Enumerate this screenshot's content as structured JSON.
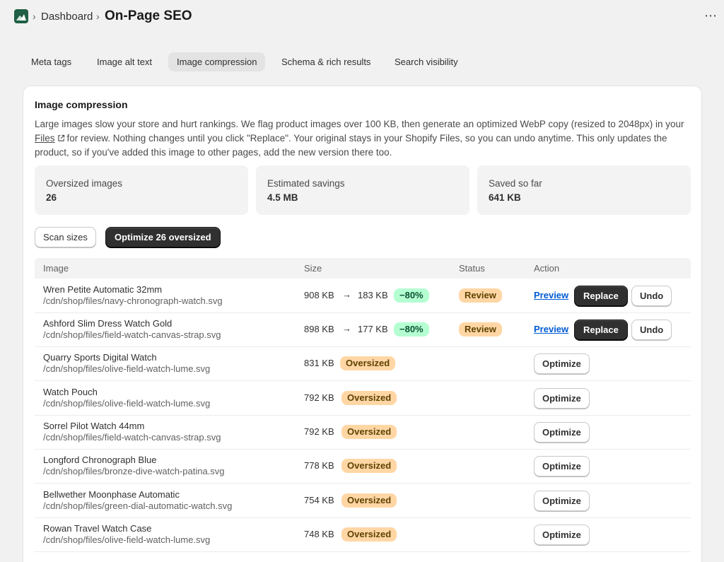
{
  "header": {
    "breadcrumb_sep": "›",
    "breadcrumb_parent": "Dashboard",
    "page_title": "On-Page SEO",
    "more_icon": "⋯"
  },
  "tabs": [
    {
      "label": "Meta tags",
      "active": false
    },
    {
      "label": "Image alt text",
      "active": false
    },
    {
      "label": "Image compression",
      "active": true
    },
    {
      "label": "Schema & rich results",
      "active": false
    },
    {
      "label": "Search visibility",
      "active": false
    }
  ],
  "card": {
    "title": "Image compression",
    "desc_part1": "Large images slow your store and hurt rankings. We flag product images over 100 KB, then generate an optimized WebP copy (resized to 2048px) in your ",
    "desc_link": "Files",
    "desc_part2": "for review. Nothing changes until you click \"Replace\". Your original stays in your Shopify Files, so you can undo anytime. This only updates the product, so if you've added this image to other pages, add the new version there too."
  },
  "stats": [
    {
      "label": "Oversized images",
      "value": "26"
    },
    {
      "label": "Estimated savings",
      "value": "4.5 MB"
    },
    {
      "label": "Saved so far",
      "value": "641 KB"
    }
  ],
  "buttons": {
    "scan": "Scan sizes",
    "optimize_all": "Optimize 26 oversized"
  },
  "table": {
    "headers": {
      "image": "Image",
      "size": "Size",
      "status": "Status",
      "action": "Action"
    },
    "arrow": "→",
    "rows": [
      {
        "name": "Wren Petite Automatic 32mm",
        "path": "/cdn/shop/files/navy-chronograph-watch.svg",
        "size": "908 KB",
        "new_size": "183 KB",
        "savings": "−80%",
        "status": "Review",
        "preview": "Preview",
        "replace": "Replace",
        "undo": "Undo"
      },
      {
        "name": "Ashford Slim Dress Watch Gold",
        "path": "/cdn/shop/files/field-watch-canvas-strap.svg",
        "size": "898 KB",
        "new_size": "177 KB",
        "savings": "−80%",
        "status": "Review",
        "preview": "Preview",
        "replace": "Replace",
        "undo": "Undo"
      },
      {
        "name": "Quarry Sports Digital Watch",
        "path": "/cdn/shop/files/olive-field-watch-lume.svg",
        "size": "831 KB",
        "badge": "Oversized",
        "action": "Optimize"
      },
      {
        "name": "Watch Pouch",
        "path": "/cdn/shop/files/olive-field-watch-lume.svg",
        "size": "792 KB",
        "badge": "Oversized",
        "action": "Optimize"
      },
      {
        "name": "Sorrel Pilot Watch 44mm",
        "path": "/cdn/shop/files/field-watch-canvas-strap.svg",
        "size": "792 KB",
        "badge": "Oversized",
        "action": "Optimize"
      },
      {
        "name": "Longford Chronograph Blue",
        "path": "/cdn/shop/files/bronze-dive-watch-patina.svg",
        "size": "778 KB",
        "badge": "Oversized",
        "action": "Optimize"
      },
      {
        "name": "Bellwether Moonphase Automatic",
        "path": "/cdn/shop/files/green-dial-automatic-watch.svg",
        "size": "754 KB",
        "badge": "Oversized",
        "action": "Optimize"
      },
      {
        "name": "Rowan Travel Watch Case",
        "path": "/cdn/shop/files/olive-field-watch-lume.svg",
        "size": "748 KB",
        "badge": "Oversized",
        "action": "Optimize"
      }
    ]
  },
  "colors": {
    "page_bg": "#f1f1f1",
    "card_bg": "#ffffff",
    "primary_button": "#303030",
    "badge_green": "#b4fed2",
    "badge_orange": "#ffd6a4",
    "link": "#005bd3",
    "logo": "#1f5f45"
  }
}
